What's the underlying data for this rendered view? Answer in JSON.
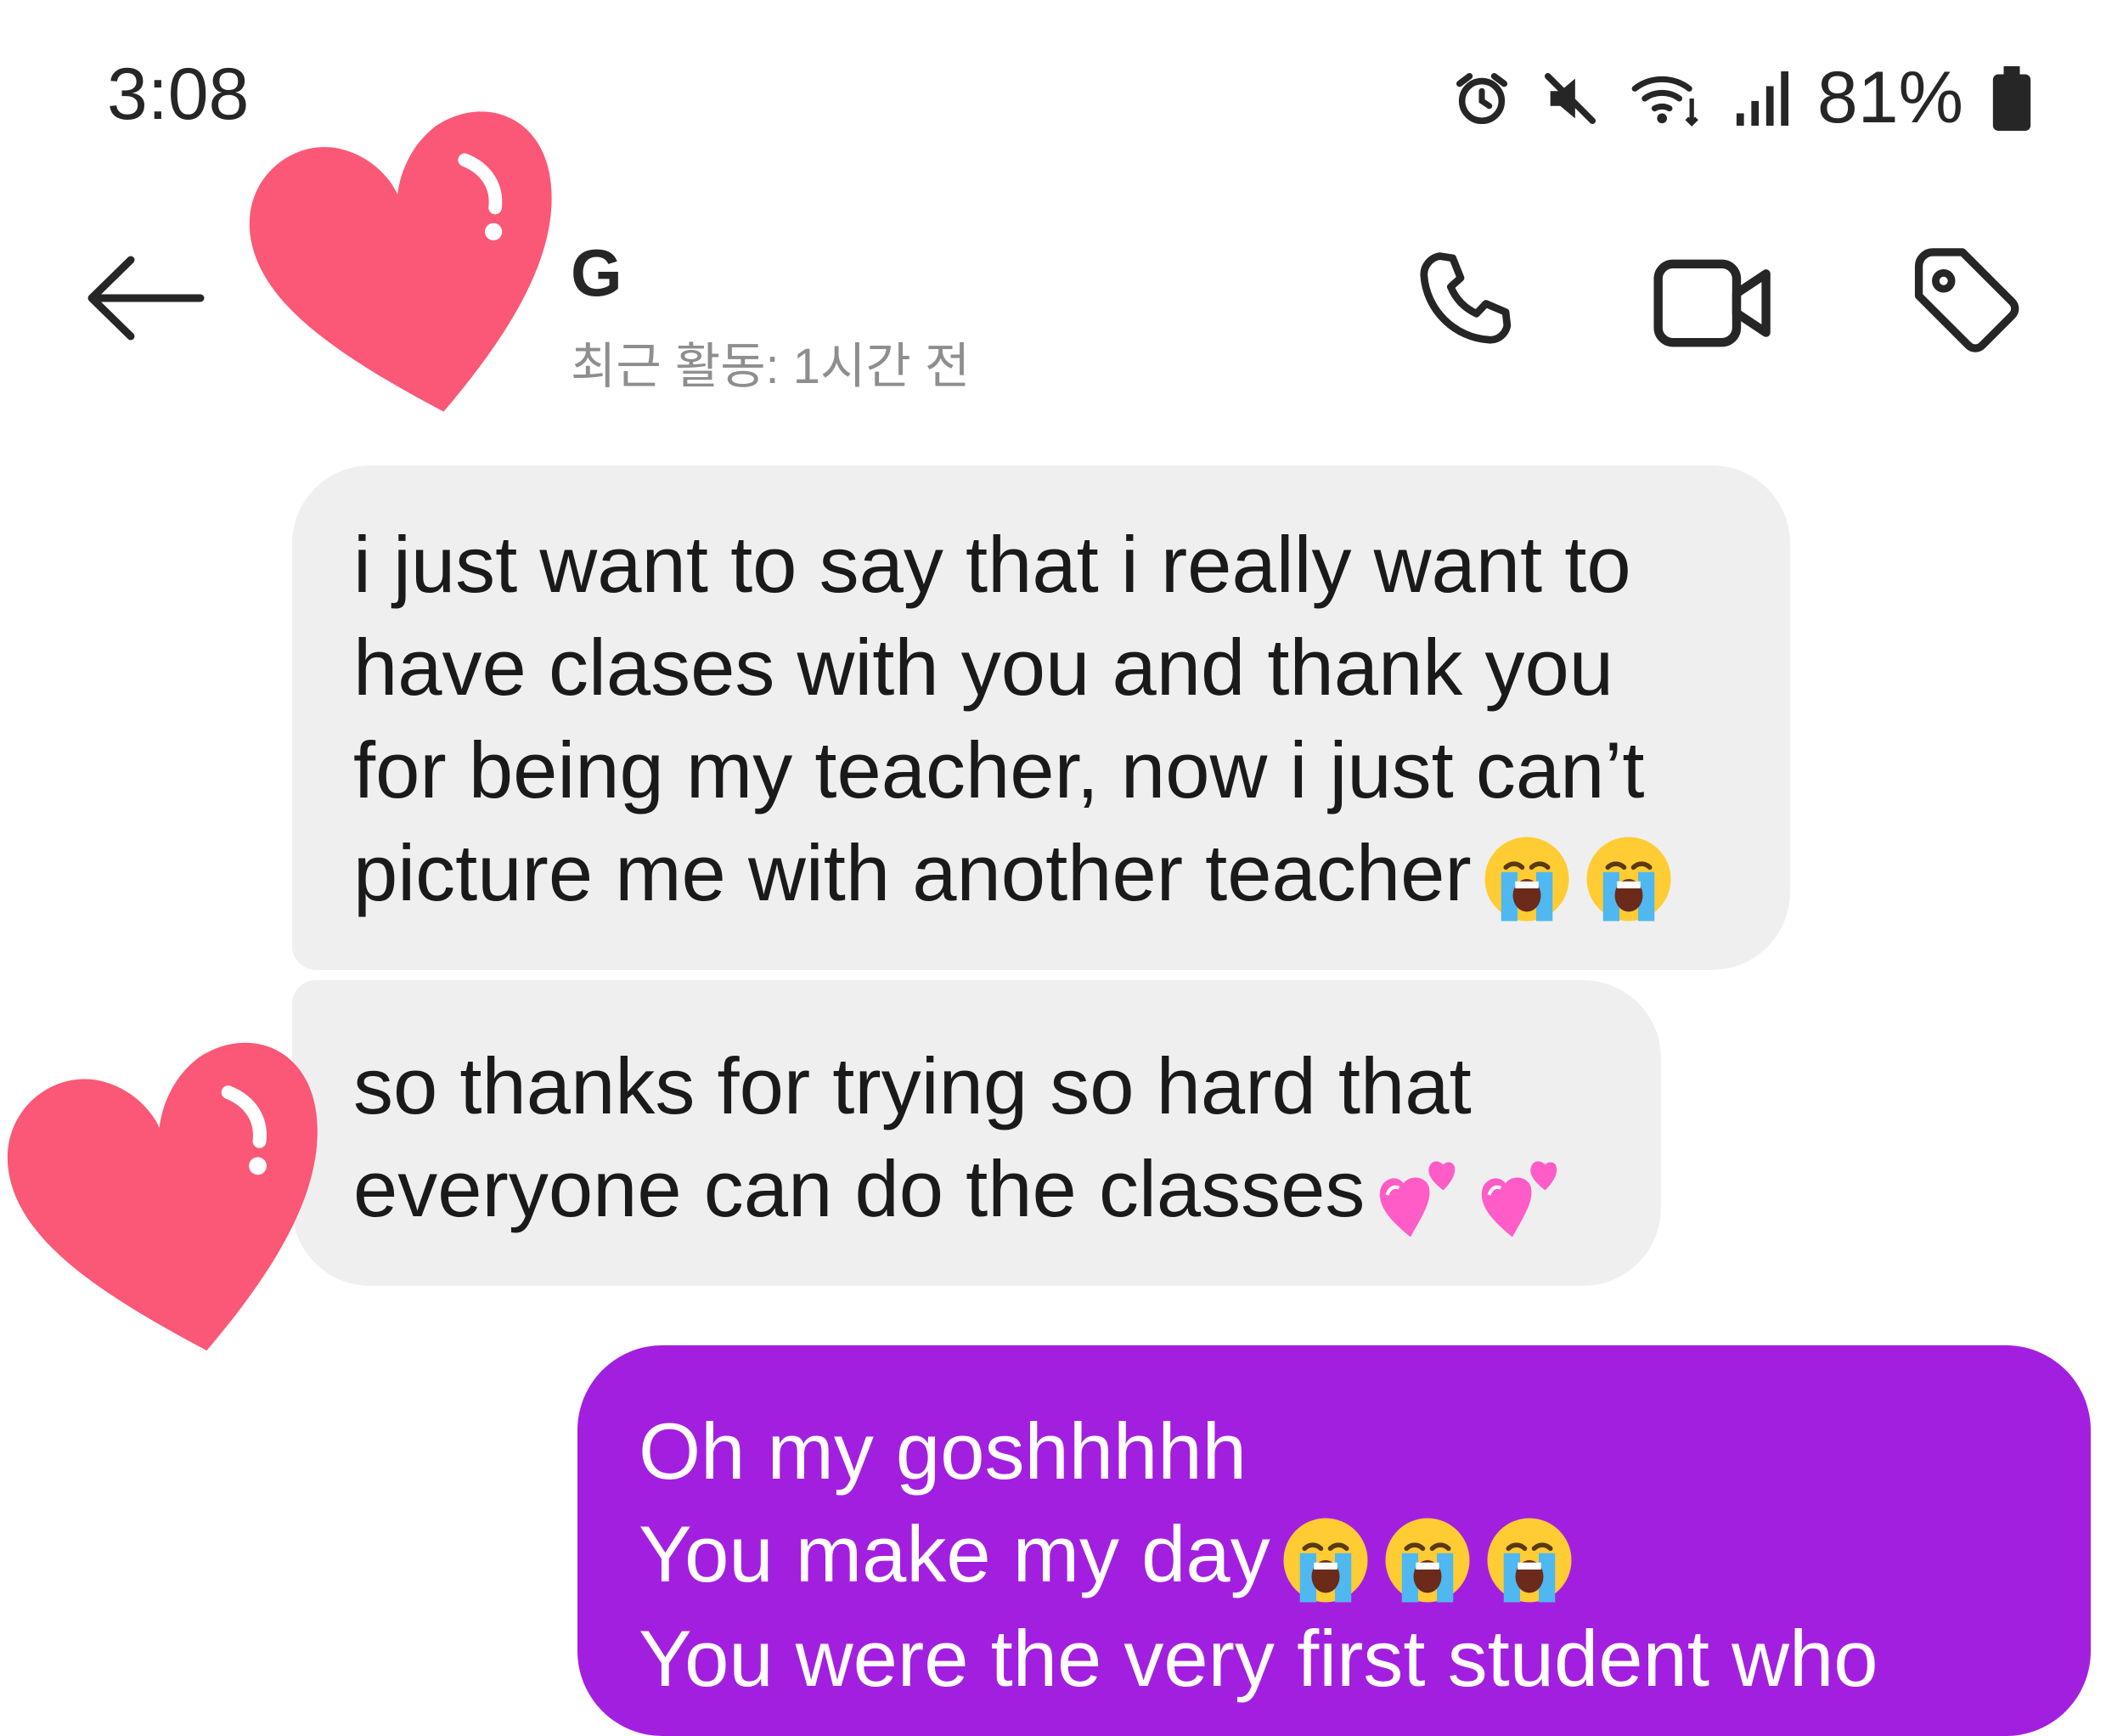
{
  "status_bar": {
    "time": "3:08",
    "battery": "81%",
    "icons": [
      "alarm-icon",
      "mute-icon",
      "wifi-icon",
      "signal-icon",
      "battery-icon"
    ]
  },
  "header": {
    "back_icon": "back-arrow-icon",
    "contact_name": "G",
    "contact_status": "최근 활동: 1시간 전",
    "actions": [
      "phone-icon",
      "video-camera-icon",
      "tag-icon"
    ]
  },
  "messages": [
    {
      "sender": "other",
      "lines": [
        "i just want to say that i really want to",
        "have clases with you and thank you",
        "for being my teacher, now i just can’t",
        "picture me with another teacher"
      ],
      "emoji": [
        "loudly-crying-face",
        "loudly-crying-face"
      ]
    },
    {
      "sender": "other",
      "lines": [
        "so thanks for trying so hard that",
        "everyone can do the classes"
      ],
      "emoji": [
        "two-hearts",
        "two-hearts"
      ]
    },
    {
      "sender": "me",
      "lines": [
        "Oh my goshhhhh",
        "You make my day",
        "You were the very first student who"
      ],
      "emoji": [
        "loudly-crying-face",
        "loudly-crying-face",
        "loudly-crying-face"
      ]
    }
  ],
  "decorations": [
    "heart-sticker-avatar",
    "heart-sticker-message"
  ],
  "colors": {
    "received_bubble": "#efefef",
    "sent_bubble": "#a31fe0",
    "heart": "#fa5876",
    "secondary_text": "#8e8e8e"
  }
}
